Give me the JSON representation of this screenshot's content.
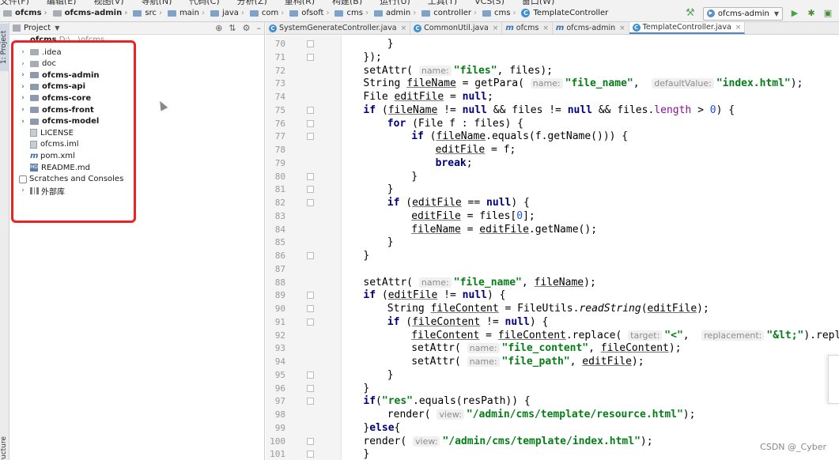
{
  "breadcrumb": [
    {
      "label": "ofcms",
      "bold": true,
      "icon": "folder-icon"
    },
    {
      "label": "ofcms-admin",
      "bold": true,
      "icon": "folder-icon"
    },
    {
      "label": "src",
      "icon": "folder-icon"
    },
    {
      "label": "main",
      "icon": "folder-icon"
    },
    {
      "label": "java",
      "icon": "folder-icon"
    },
    {
      "label": "com",
      "icon": "folder-icon"
    },
    {
      "label": "ofsoft",
      "icon": "folder-icon"
    },
    {
      "label": "cms",
      "icon": "folder-icon"
    },
    {
      "label": "admin",
      "icon": "folder-icon"
    },
    {
      "label": "controller",
      "icon": "folder-icon"
    },
    {
      "label": "cms",
      "icon": "folder-icon"
    },
    {
      "label": "TemplateController",
      "icon": "class-icon"
    }
  ],
  "run_config": "ofcms-admin",
  "left_strip": {
    "project_tab": "1: Project",
    "structure_tab": "Z: Structure"
  },
  "project_panel": {
    "title": "Project",
    "root_label": "ofcms",
    "root_path": "D:\\...\\ofcms"
  },
  "tree": [
    {
      "label": ".idea",
      "kind": "folder",
      "chevron": true,
      "bold": false
    },
    {
      "label": "doc",
      "kind": "folder",
      "chevron": true,
      "bold": false
    },
    {
      "label": "ofcms-admin",
      "kind": "module",
      "chevron": true,
      "bold": true
    },
    {
      "label": "ofcms-api",
      "kind": "module",
      "chevron": true,
      "bold": true
    },
    {
      "label": "ofcms-core",
      "kind": "module",
      "chevron": true,
      "bold": true
    },
    {
      "label": "ofcms-front",
      "kind": "module",
      "chevron": true,
      "bold": true
    },
    {
      "label": "ofcms-model",
      "kind": "module",
      "chevron": true,
      "bold": true
    },
    {
      "label": "LICENSE",
      "kind": "file",
      "chevron": false,
      "bold": false
    },
    {
      "label": "ofcms.iml",
      "kind": "file",
      "chevron": false,
      "bold": false
    },
    {
      "label": "pom.xml",
      "kind": "maven",
      "chevron": false,
      "bold": false
    },
    {
      "label": "README.md",
      "kind": "markdown",
      "chevron": false,
      "bold": false
    },
    {
      "label": "Scratches and Consoles",
      "kind": "scratch",
      "chevron": false,
      "bold": false
    },
    {
      "label": "外部库",
      "kind": "library",
      "chevron": true,
      "bold": false
    }
  ],
  "tabs": [
    {
      "label": "SystemGenerateController.java",
      "icon": "class-icon",
      "active": false
    },
    {
      "label": "CommonUtil.java",
      "icon": "class-icon",
      "active": false
    },
    {
      "label": "ofcms",
      "icon": "maven-icon",
      "active": false
    },
    {
      "label": "ofcms-admin",
      "icon": "maven-icon",
      "active": false
    },
    {
      "label": "TemplateController.java",
      "icon": "class-icon",
      "active": true
    }
  ],
  "code": {
    "line_numbers": [
      70,
      71,
      72,
      73,
      74,
      75,
      76,
      77,
      78,
      79,
      80,
      81,
      82,
      83,
      84,
      85,
      86,
      87,
      88,
      89,
      90,
      91,
      92,
      93,
      94,
      95,
      96,
      97,
      98,
      99,
      100,
      101
    ],
    "fold_rows": [
      0,
      1,
      5,
      6,
      7,
      10,
      11,
      12,
      16,
      19,
      20,
      21,
      25,
      26,
      27,
      30,
      31
    ],
    "lines": [
      [
        [
          8,
          ""
        ],
        [
          "p",
          "}"
        ]
      ],
      [
        [
          4,
          ""
        ],
        [
          "p",
          "});"
        ]
      ],
      [
        [
          4,
          ""
        ],
        [
          "p",
          "setAttr( "
        ],
        [
          "h",
          "name:"
        ],
        [
          "s",
          "\"files\""
        ],
        [
          "p",
          ", files);"
        ]
      ],
      [
        [
          4,
          ""
        ],
        [
          "p",
          "String "
        ],
        [
          "v",
          "fileName"
        ],
        [
          "p",
          " = getPara( "
        ],
        [
          "h",
          "name:"
        ],
        [
          "s",
          "\"file_name\""
        ],
        [
          "p",
          ",  "
        ],
        [
          "h",
          "defaultValue:"
        ],
        [
          "s",
          "\"index.html\""
        ],
        [
          "p",
          ");"
        ]
      ],
      [
        [
          4,
          ""
        ],
        [
          "p",
          "File "
        ],
        [
          "v",
          "editFile"
        ],
        [
          "p",
          " = "
        ],
        [
          "k",
          "null"
        ],
        [
          "p",
          ";"
        ]
      ],
      [
        [
          4,
          ""
        ],
        [
          "k",
          "if"
        ],
        [
          "p",
          " ("
        ],
        [
          "v",
          "fileName"
        ],
        [
          "p",
          " != "
        ],
        [
          "k",
          "null"
        ],
        [
          "p",
          " && files != "
        ],
        [
          "k",
          "null"
        ],
        [
          "p",
          " && files."
        ],
        [
          "f",
          "length"
        ],
        [
          "p",
          " > "
        ],
        [
          "n",
          "0"
        ],
        [
          "p",
          ") {"
        ]
      ],
      [
        [
          8,
          ""
        ],
        [
          "k",
          "for"
        ],
        [
          "p",
          " (File f : files) {"
        ]
      ],
      [
        [
          12,
          ""
        ],
        [
          "k",
          "if"
        ],
        [
          "p",
          " ("
        ],
        [
          "v",
          "fileName"
        ],
        [
          "p",
          ".equals(f.getName())) {"
        ]
      ],
      [
        [
          16,
          ""
        ],
        [
          "v",
          "editFile"
        ],
        [
          "p",
          " = f;"
        ]
      ],
      [
        [
          16,
          ""
        ],
        [
          "k",
          "break"
        ],
        [
          "p",
          ";"
        ]
      ],
      [
        [
          12,
          ""
        ],
        [
          "p",
          "}"
        ]
      ],
      [
        [
          8,
          ""
        ],
        [
          "p",
          "}"
        ]
      ],
      [
        [
          8,
          ""
        ],
        [
          "k",
          "if"
        ],
        [
          "p",
          " ("
        ],
        [
          "v",
          "editFile"
        ],
        [
          "p",
          " == "
        ],
        [
          "k",
          "null"
        ],
        [
          "p",
          ") {"
        ]
      ],
      [
        [
          12,
          ""
        ],
        [
          "v",
          "editFile"
        ],
        [
          "p",
          " = files["
        ],
        [
          "n",
          "0"
        ],
        [
          "p",
          "];"
        ]
      ],
      [
        [
          12,
          ""
        ],
        [
          "v",
          "fileName"
        ],
        [
          "p",
          " = "
        ],
        [
          "v",
          "editFile"
        ],
        [
          "p",
          ".getName();"
        ]
      ],
      [
        [
          8,
          ""
        ],
        [
          "p",
          "}"
        ]
      ],
      [
        [
          4,
          ""
        ],
        [
          "p",
          "}"
        ]
      ],
      [
        [
          0,
          ""
        ]
      ],
      [
        [
          4,
          ""
        ],
        [
          "p",
          "setAttr( "
        ],
        [
          "h",
          "name:"
        ],
        [
          "s",
          "\"file_name\""
        ],
        [
          "p",
          ", "
        ],
        [
          "v",
          "fileName"
        ],
        [
          "p",
          ");"
        ]
      ],
      [
        [
          4,
          ""
        ],
        [
          "k",
          "if"
        ],
        [
          "p",
          " ("
        ],
        [
          "v",
          "editFile"
        ],
        [
          "p",
          " != "
        ],
        [
          "k",
          "null"
        ],
        [
          "p",
          ") {"
        ]
      ],
      [
        [
          8,
          ""
        ],
        [
          "p",
          "String "
        ],
        [
          "v",
          "fileContent"
        ],
        [
          "p",
          " = FileUtils."
        ],
        [
          "i",
          "readString"
        ],
        [
          "p",
          "("
        ],
        [
          "v",
          "editFile"
        ],
        [
          "p",
          ");"
        ]
      ],
      [
        [
          8,
          ""
        ],
        [
          "k",
          "if"
        ],
        [
          "p",
          " ("
        ],
        [
          "v",
          "fileContent"
        ],
        [
          "p",
          " != "
        ],
        [
          "k",
          "null"
        ],
        [
          "p",
          ") {"
        ]
      ],
      [
        [
          12,
          ""
        ],
        [
          "v",
          "fileContent"
        ],
        [
          "p",
          " = "
        ],
        [
          "v",
          "fileContent"
        ],
        [
          "p",
          ".replace( "
        ],
        [
          "h",
          "target:"
        ],
        [
          "s",
          "\"<\""
        ],
        [
          "p",
          ",  "
        ],
        [
          "h",
          "replacement:"
        ],
        [
          "s",
          "\"&lt;\""
        ],
        [
          "p",
          ").repla"
        ]
      ],
      [
        [
          12,
          ""
        ],
        [
          "p",
          "setAttr( "
        ],
        [
          "h",
          "name:"
        ],
        [
          "s",
          "\"file_content\""
        ],
        [
          "p",
          ", "
        ],
        [
          "v",
          "fileContent"
        ],
        [
          "p",
          ");"
        ]
      ],
      [
        [
          12,
          ""
        ],
        [
          "p",
          "setAttr( "
        ],
        [
          "h",
          "name:"
        ],
        [
          "s",
          "\"file_path\""
        ],
        [
          "p",
          ", "
        ],
        [
          "v",
          "editFile"
        ],
        [
          "p",
          ");"
        ]
      ],
      [
        [
          8,
          ""
        ],
        [
          "p",
          "}"
        ]
      ],
      [
        [
          4,
          ""
        ],
        [
          "p",
          "}"
        ]
      ],
      [
        [
          4,
          ""
        ],
        [
          "k",
          "if"
        ],
        [
          "p",
          "("
        ],
        [
          "s",
          "\"res\""
        ],
        [
          "p",
          ".equals(resPath)) {"
        ]
      ],
      [
        [
          8,
          ""
        ],
        [
          "p",
          "render( "
        ],
        [
          "h",
          "view:"
        ],
        [
          "s",
          "\"/admin/cms/template/resource.html\""
        ],
        [
          "p",
          ");"
        ]
      ],
      [
        [
          4,
          ""
        ],
        [
          "p",
          "}"
        ],
        [
          "k",
          "else"
        ],
        [
          "p",
          "{"
        ]
      ],
      [
        [
          4,
          ""
        ],
        [
          "p",
          "render( "
        ],
        [
          "h",
          "view:"
        ],
        [
          "s",
          "\"/admin/cms/template/index.html\""
        ],
        [
          "p",
          ");"
        ]
      ],
      [
        [
          4,
          ""
        ],
        [
          "p",
          "}"
        ]
      ]
    ]
  },
  "watermark": "CSDN @_Cyber"
}
